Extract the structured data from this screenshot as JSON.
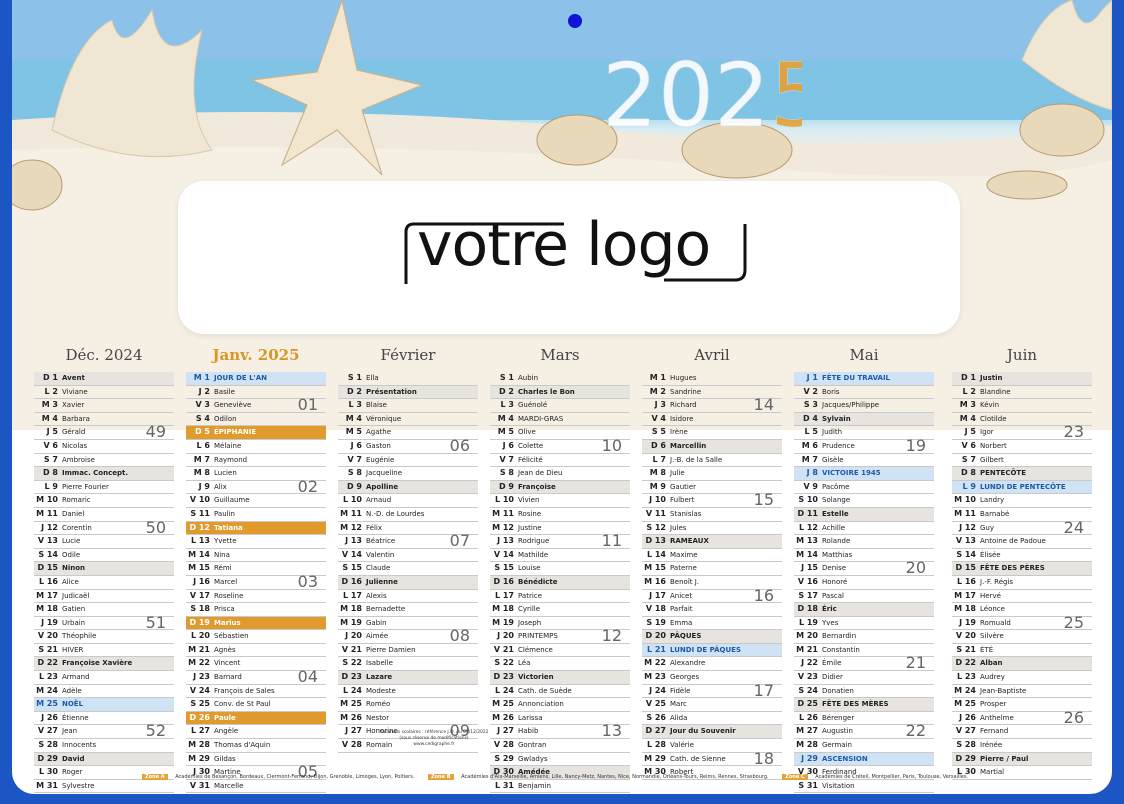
{
  "year": "2025",
  "logo": "votre logo",
  "note": [
    "Vacances scolaires : référence J.O. du 09/12/2022",
    "(sous réserve de modifications)",
    "www.cedigraphe.fr"
  ],
  "footer": [
    {
      "zone": "Zone A",
      "text": "Académies de Besançon, Bordeaux, Clermont-Ferrand, Dijon, Grenoble, Limoges, Lyon, Poitiers."
    },
    {
      "zone": "Zone B",
      "text": "Académies d'Aix-Marseille, Amiens, Lille, Nancy-Metz, Nantes, Nice, Normandie, Orléans-Tours, Reims, Rennes, Strasbourg."
    },
    {
      "zone": "Zone C",
      "text": "Académies de Créteil, Montpellier, Paris, Toulouse, Versailles."
    }
  ],
  "months": [
    {
      "name": "Déc. 2024",
      "rows": [
        [
          "D",
          "1",
          "Avent",
          "sun"
        ],
        [
          "L",
          "2",
          "Viviane"
        ],
        [
          "M",
          "3",
          "Xavier"
        ],
        [
          "M",
          "4",
          "Barbara"
        ],
        [
          "J",
          "5",
          "Gérald",
          "",
          "49"
        ],
        [
          "V",
          "6",
          "Nicolas"
        ],
        [
          "S",
          "7",
          "Ambroise"
        ],
        [
          "D",
          "8",
          "Immac. Concept.",
          "sun"
        ],
        [
          "L",
          "9",
          "Pierre Fourier"
        ],
        [
          "M",
          "10",
          "Romaric"
        ],
        [
          "M",
          "11",
          "Daniel"
        ],
        [
          "J",
          "12",
          "Corentin",
          "",
          "50"
        ],
        [
          "V",
          "13",
          "Lucie"
        ],
        [
          "S",
          "14",
          "Odile"
        ],
        [
          "D",
          "15",
          "Ninon",
          "sun"
        ],
        [
          "L",
          "16",
          "Alice"
        ],
        [
          "M",
          "17",
          "Judicaël"
        ],
        [
          "M",
          "18",
          "Gatien"
        ],
        [
          "J",
          "19",
          "Urbain",
          "",
          "51"
        ],
        [
          "V",
          "20",
          "Théophile"
        ],
        [
          "S",
          "21",
          "HIVER"
        ],
        [
          "D",
          "22",
          "Françoise Xavière",
          "sun"
        ],
        [
          "L",
          "23",
          "Armand"
        ],
        [
          "M",
          "24",
          "Adèle"
        ],
        [
          "M",
          "25",
          "NOËL",
          "hb"
        ],
        [
          "J",
          "26",
          "Étienne"
        ],
        [
          "V",
          "27",
          "Jean",
          "",
          "52"
        ],
        [
          "S",
          "28",
          "Innocents"
        ],
        [
          "D",
          "29",
          "David",
          "sun"
        ],
        [
          "L",
          "30",
          "Roger"
        ],
        [
          "M",
          "31",
          "Sylvestre"
        ]
      ]
    },
    {
      "name": "Janv. 2025",
      "cur": true,
      "rows": [
        [
          "M",
          "1",
          "JOUR DE L'AN",
          "hb"
        ],
        [
          "J",
          "2",
          "Basile"
        ],
        [
          "V",
          "3",
          "Geneviève",
          "",
          "01"
        ],
        [
          "S",
          "4",
          "Odilon"
        ],
        [
          "D",
          "5",
          "ÉPIPHANIE",
          "ho"
        ],
        [
          "L",
          "6",
          "Mélaine"
        ],
        [
          "M",
          "7",
          "Raymond"
        ],
        [
          "M",
          "8",
          "Lucien"
        ],
        [
          "J",
          "9",
          "Alix",
          "",
          "02"
        ],
        [
          "V",
          "10",
          "Guillaume"
        ],
        [
          "S",
          "11",
          "Paulin"
        ],
        [
          "D",
          "12",
          "Tatiana",
          "ho"
        ],
        [
          "L",
          "13",
          "Yvette"
        ],
        [
          "M",
          "14",
          "Nina"
        ],
        [
          "M",
          "15",
          "Rémi"
        ],
        [
          "J",
          "16",
          "Marcel",
          "",
          "03"
        ],
        [
          "V",
          "17",
          "Roseline"
        ],
        [
          "S",
          "18",
          "Prisca"
        ],
        [
          "D",
          "19",
          "Marius",
          "ho"
        ],
        [
          "L",
          "20",
          "Sébastien"
        ],
        [
          "M",
          "21",
          "Agnès"
        ],
        [
          "M",
          "22",
          "Vincent"
        ],
        [
          "J",
          "23",
          "Barnard",
          "",
          "04"
        ],
        [
          "V",
          "24",
          "François de Sales"
        ],
        [
          "S",
          "25",
          "Conv. de St Paul"
        ],
        [
          "D",
          "26",
          "Paule",
          "ho"
        ],
        [
          "L",
          "27",
          "Angèle"
        ],
        [
          "M",
          "28",
          "Thomas d'Aquin"
        ],
        [
          "M",
          "29",
          "Gildas"
        ],
        [
          "J",
          "30",
          "Martine",
          "",
          "05"
        ],
        [
          "V",
          "31",
          "Marcelle"
        ]
      ]
    },
    {
      "name": "Février",
      "rows": [
        [
          "S",
          "1",
          "Ella"
        ],
        [
          "D",
          "2",
          "Présentation",
          "sun"
        ],
        [
          "L",
          "3",
          "Blaise"
        ],
        [
          "M",
          "4",
          "Véronique"
        ],
        [
          "M",
          "5",
          "Agathe"
        ],
        [
          "J",
          "6",
          "Gaston",
          "",
          "06"
        ],
        [
          "V",
          "7",
          "Eugénie"
        ],
        [
          "S",
          "8",
          "Jacqueline"
        ],
        [
          "D",
          "9",
          "Apolline",
          "sun"
        ],
        [
          "L",
          "10",
          "Arnaud"
        ],
        [
          "M",
          "11",
          "N.-D. de Lourdes"
        ],
        [
          "M",
          "12",
          "Félix"
        ],
        [
          "J",
          "13",
          "Béatrice",
          "",
          "07"
        ],
        [
          "V",
          "14",
          "Valentin"
        ],
        [
          "S",
          "15",
          "Claude"
        ],
        [
          "D",
          "16",
          "Julienne",
          "sun"
        ],
        [
          "L",
          "17",
          "Alexis"
        ],
        [
          "M",
          "18",
          "Bernadette"
        ],
        [
          "M",
          "19",
          "Gabin"
        ],
        [
          "J",
          "20",
          "Aimée",
          "",
          "08"
        ],
        [
          "V",
          "21",
          "Pierre Damien"
        ],
        [
          "S",
          "22",
          "Isabelle"
        ],
        [
          "D",
          "23",
          "Lazare",
          "sun"
        ],
        [
          "L",
          "24",
          "Modeste"
        ],
        [
          "M",
          "25",
          "Roméo"
        ],
        [
          "M",
          "26",
          "Nestor"
        ],
        [
          "J",
          "27",
          "Honorine",
          "",
          "09"
        ],
        [
          "V",
          "28",
          "Romain"
        ]
      ]
    },
    {
      "name": "Mars",
      "rows": [
        [
          "S",
          "1",
          "Aubin"
        ],
        [
          "D",
          "2",
          "Charles le Bon",
          "sun"
        ],
        [
          "L",
          "3",
          "Guénolé"
        ],
        [
          "M",
          "4",
          "MARDI-GRAS"
        ],
        [
          "M",
          "5",
          "Olive"
        ],
        [
          "J",
          "6",
          "Colette",
          "",
          "10"
        ],
        [
          "V",
          "7",
          "Félicité"
        ],
        [
          "S",
          "8",
          "Jean de Dieu"
        ],
        [
          "D",
          "9",
          "Françoise",
          "sun"
        ],
        [
          "L",
          "10",
          "Vivien"
        ],
        [
          "M",
          "11",
          "Rosine"
        ],
        [
          "M",
          "12",
          "Justine"
        ],
        [
          "J",
          "13",
          "Rodrigue",
          "",
          "11"
        ],
        [
          "V",
          "14",
          "Mathilde"
        ],
        [
          "S",
          "15",
          "Louise"
        ],
        [
          "D",
          "16",
          "Bénédicte",
          "sun"
        ],
        [
          "L",
          "17",
          "Patrice"
        ],
        [
          "M",
          "18",
          "Cyrille"
        ],
        [
          "M",
          "19",
          "Joseph"
        ],
        [
          "J",
          "20",
          "PRINTEMPS",
          "",
          "12"
        ],
        [
          "V",
          "21",
          "Clémence"
        ],
        [
          "S",
          "22",
          "Léa"
        ],
        [
          "D",
          "23",
          "Victorien",
          "sun"
        ],
        [
          "L",
          "24",
          "Cath. de Suède"
        ],
        [
          "M",
          "25",
          "Annonciation"
        ],
        [
          "M",
          "26",
          "Larissa"
        ],
        [
          "J",
          "27",
          "Habib",
          "",
          "13"
        ],
        [
          "V",
          "28",
          "Gontran"
        ],
        [
          "S",
          "29",
          "Gwladys"
        ],
        [
          "D",
          "30",
          "Amédée",
          "sun"
        ],
        [
          "L",
          "31",
          "Benjamin"
        ]
      ]
    },
    {
      "name": "Avril",
      "rows": [
        [
          "M",
          "1",
          "Hugues"
        ],
        [
          "M",
          "2",
          "Sandrine"
        ],
        [
          "J",
          "3",
          "Richard",
          "",
          "14"
        ],
        [
          "V",
          "4",
          "Isidore"
        ],
        [
          "S",
          "5",
          "Irène"
        ],
        [
          "D",
          "6",
          "Marcellin",
          "sun"
        ],
        [
          "L",
          "7",
          "J.-B. de la Salle"
        ],
        [
          "M",
          "8",
          "Julie"
        ],
        [
          "M",
          "9",
          "Gautier"
        ],
        [
          "J",
          "10",
          "Fulbert",
          "",
          "15"
        ],
        [
          "V",
          "11",
          "Stanislas"
        ],
        [
          "S",
          "12",
          "Jules"
        ],
        [
          "D",
          "13",
          "RAMEAUX",
          "sun"
        ],
        [
          "L",
          "14",
          "Maxime"
        ],
        [
          "M",
          "15",
          "Paterne"
        ],
        [
          "M",
          "16",
          "Benoît J."
        ],
        [
          "J",
          "17",
          "Anicet",
          "",
          "16"
        ],
        [
          "V",
          "18",
          "Parfait"
        ],
        [
          "S",
          "19",
          "Emma"
        ],
        [
          "D",
          "20",
          "PÂQUES",
          "sun"
        ],
        [
          "L",
          "21",
          "LUNDI DE PÂQUES",
          "hb"
        ],
        [
          "M",
          "22",
          "Alexandre"
        ],
        [
          "M",
          "23",
          "Georges"
        ],
        [
          "J",
          "24",
          "Fidèle",
          "",
          "17"
        ],
        [
          "V",
          "25",
          "Marc"
        ],
        [
          "S",
          "26",
          "Alida"
        ],
        [
          "D",
          "27",
          "Jour du Souvenir",
          "sun"
        ],
        [
          "L",
          "28",
          "Valérie"
        ],
        [
          "M",
          "29",
          "Cath. de Sienne",
          "",
          "18"
        ],
        [
          "M",
          "30",
          "Robert"
        ]
      ]
    },
    {
      "name": "Mai",
      "rows": [
        [
          "J",
          "1",
          "FÊTE DU TRAVAIL",
          "hb"
        ],
        [
          "V",
          "2",
          "Boris"
        ],
        [
          "S",
          "3",
          "Jacques/Philippe"
        ],
        [
          "D",
          "4",
          "Sylvain",
          "sun"
        ],
        [
          "L",
          "5",
          "Judith"
        ],
        [
          "M",
          "6",
          "Prudence",
          "",
          "19"
        ],
        [
          "M",
          "7",
          "Gisèle"
        ],
        [
          "J",
          "8",
          "VICTOIRE 1945",
          "hb"
        ],
        [
          "V",
          "9",
          "Pacôme"
        ],
        [
          "S",
          "10",
          "Solange"
        ],
        [
          "D",
          "11",
          "Estelle",
          "sun"
        ],
        [
          "L",
          "12",
          "Achille"
        ],
        [
          "M",
          "13",
          "Rolande"
        ],
        [
          "M",
          "14",
          "Matthias"
        ],
        [
          "J",
          "15",
          "Denise",
          "",
          "20"
        ],
        [
          "V",
          "16",
          "Honoré"
        ],
        [
          "S",
          "17",
          "Pascal"
        ],
        [
          "D",
          "18",
          "Éric",
          "sun"
        ],
        [
          "L",
          "19",
          "Yves"
        ],
        [
          "M",
          "20",
          "Bernardin"
        ],
        [
          "M",
          "21",
          "Constantin"
        ],
        [
          "J",
          "22",
          "Émile",
          "",
          "21"
        ],
        [
          "V",
          "23",
          "Didier"
        ],
        [
          "S",
          "24",
          "Donatien"
        ],
        [
          "D",
          "25",
          "FÊTE DES MÈRES",
          "sun"
        ],
        [
          "L",
          "26",
          "Bérenger"
        ],
        [
          "M",
          "27",
          "Augustin",
          "",
          "22"
        ],
        [
          "M",
          "28",
          "Germain"
        ],
        [
          "J",
          "29",
          "ASCENSION",
          "hb"
        ],
        [
          "V",
          "30",
          "Ferdinand"
        ],
        [
          "S",
          "31",
          "Visitation"
        ]
      ]
    },
    {
      "name": "Juin",
      "rows": [
        [
          "D",
          "1",
          "Justin",
          "sun"
        ],
        [
          "L",
          "2",
          "Blandine"
        ],
        [
          "M",
          "3",
          "Kévin"
        ],
        [
          "M",
          "4",
          "Clotilde"
        ],
        [
          "J",
          "5",
          "Igor",
          "",
          "23"
        ],
        [
          "V",
          "6",
          "Norbert"
        ],
        [
          "S",
          "7",
          "Gilbert"
        ],
        [
          "D",
          "8",
          "PENTECÔTE",
          "sun"
        ],
        [
          "L",
          "9",
          "LUNDI DE PENTECÔTE",
          "hb"
        ],
        [
          "M",
          "10",
          "Landry"
        ],
        [
          "M",
          "11",
          "Barnabé"
        ],
        [
          "J",
          "12",
          "Guy",
          "",
          "24"
        ],
        [
          "V",
          "13",
          "Antoine de Padoue"
        ],
        [
          "S",
          "14",
          "Élisée"
        ],
        [
          "D",
          "15",
          "FÊTE DES PÈRES",
          "sun"
        ],
        [
          "L",
          "16",
          "J.-F. Régis"
        ],
        [
          "M",
          "17",
          "Hervé"
        ],
        [
          "M",
          "18",
          "Léonce"
        ],
        [
          "J",
          "19",
          "Romuald",
          "",
          "25"
        ],
        [
          "V",
          "20",
          "Silvère"
        ],
        [
          "S",
          "21",
          "ÉTÉ"
        ],
        [
          "D",
          "22",
          "Alban",
          "sun"
        ],
        [
          "L",
          "23",
          "Audrey"
        ],
        [
          "M",
          "24",
          "Jean-Baptiste"
        ],
        [
          "M",
          "25",
          "Prosper"
        ],
        [
          "J",
          "26",
          "Anthelme",
          "",
          "26"
        ],
        [
          "V",
          "27",
          "Fernand"
        ],
        [
          "S",
          "28",
          "Irénée"
        ],
        [
          "D",
          "29",
          "Pierre / Paul",
          "sun"
        ],
        [
          "L",
          "30",
          "Martial"
        ]
      ]
    }
  ]
}
